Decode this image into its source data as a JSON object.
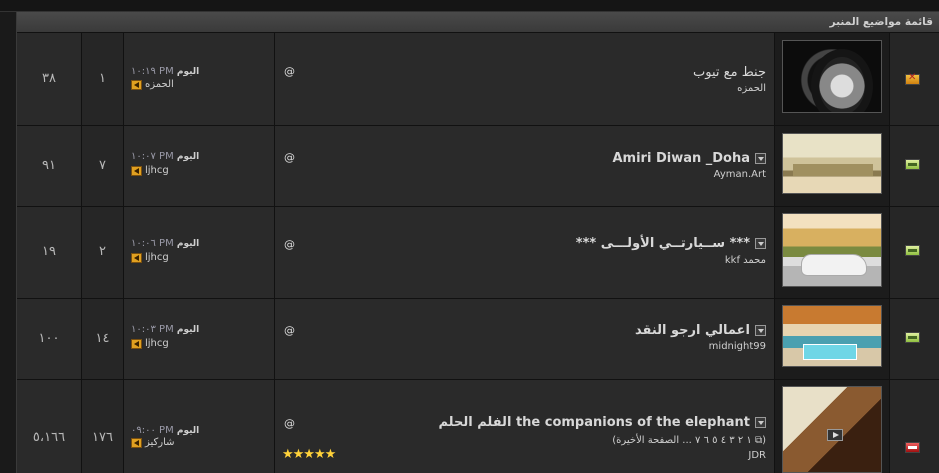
{
  "section_title": "قائمة مواضيع المنبر",
  "threads": [
    {
      "status": "hot",
      "status_icon": "hot-thread-icon",
      "title": "جنط مع تيوب",
      "title_bold": false,
      "has_dropdown": false,
      "author": "الحمزه",
      "pages": "",
      "rating": "",
      "attachment": "@",
      "last_post_day": "اليوم",
      "last_post_time": "١٠:١٩ PM",
      "last_post_user": "الحمزه",
      "replies": "١",
      "views": "٣٨"
    },
    {
      "status": "new",
      "status_icon": "new-posts-icon",
      "title": "Amiri Diwan _Doha",
      "title_bold": true,
      "has_dropdown": true,
      "author": "Ayman.Art",
      "pages": "",
      "rating": "",
      "attachment": "@",
      "last_post_day": "اليوم",
      "last_post_time": "١٠:٠٧ PM",
      "last_post_user": "ljhcg",
      "replies": "٧",
      "views": "٩١"
    },
    {
      "status": "new",
      "status_icon": "new-posts-icon",
      "title": "*** ســيارتــي الأولـــى ***",
      "title_bold": true,
      "has_dropdown": true,
      "author": "محمد kkf",
      "pages": "",
      "rating": "",
      "attachment": "@",
      "last_post_day": "اليوم",
      "last_post_time": "١٠:٠٦ PM",
      "last_post_user": "ljhcg",
      "replies": "٢",
      "views": "١٩"
    },
    {
      "status": "new",
      "status_icon": "new-posts-icon",
      "title": "اعمالي ارجو النقد",
      "title_bold": true,
      "has_dropdown": true,
      "author": "midnight99",
      "pages": "",
      "rating": "",
      "attachment": "@",
      "last_post_day": "اليوم",
      "last_post_time": "١٠:٠٣ PM",
      "last_post_user": "ljhcg",
      "replies": "١٤",
      "views": "١٠٠"
    },
    {
      "status": "hot-new",
      "status_icon": "hot-new-thread-icon",
      "title": "the companions of the elephant الفلم الحلم",
      "title_bold": true,
      "has_dropdown": true,
      "author": "JDR",
      "pages": "(⧉ ١ ٢ ٣ ٤ ٥ ٦ ٧ ... الصفحة الأخيرة)",
      "rating": "★★★★★",
      "attachment": "@",
      "last_post_day": "اليوم",
      "last_post_time": "٠٩:٠٠ PM",
      "last_post_user": "شاركيز",
      "replies": "١٧٦",
      "views": "٥،١٦٦"
    }
  ]
}
